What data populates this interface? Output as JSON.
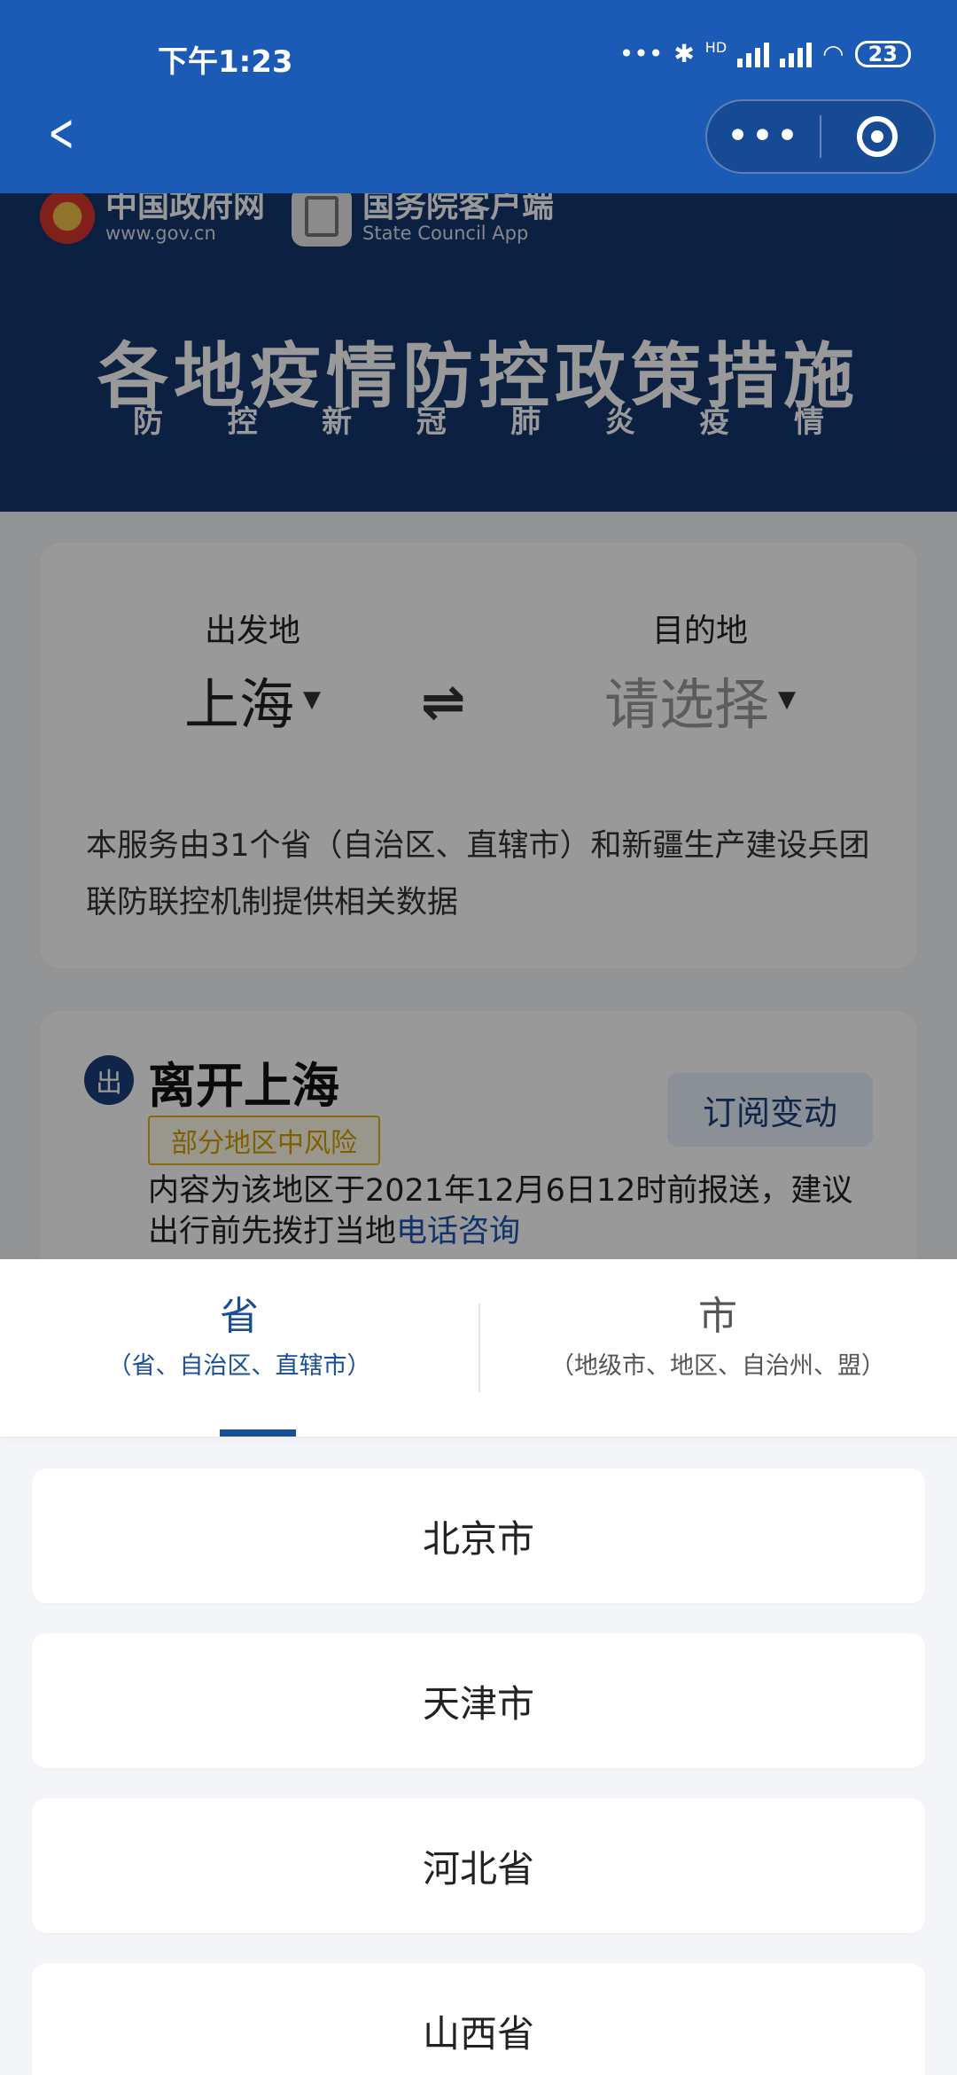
{
  "status_bar": {
    "time": "下午1:23",
    "dots": "•••",
    "hd": "HD",
    "battery": "23"
  },
  "nav": {
    "back_icon": "chevron-left-icon",
    "more": "•••",
    "close_icon": "target-icon"
  },
  "header": {
    "logo1_cn": "中国政府网",
    "logo1_en": "www.gov.cn",
    "logo2_cn": "国务院客户端",
    "logo2_en": "State Council App",
    "title": "各地疫情防控政策措施",
    "subtitle": [
      "防",
      "控",
      "新",
      "冠",
      "肺",
      "炎",
      "疫",
      "情"
    ]
  },
  "route": {
    "from_label": "出发地",
    "from_value": "上海",
    "to_label": "目的地",
    "to_value": "请选择",
    "notice": "本服务由31个省（自治区、直辖市）和新疆生产建设兵团联防联控机制提供相关数据"
  },
  "leave": {
    "badge": "出",
    "title": "离开上海",
    "risk": "部分地区中风险",
    "subscribe": "订阅变动",
    "detail": "内容为该地区于2021年12月6日12时前报送，建议出行前先拨打当地",
    "phone_link": "电话咨询"
  },
  "sheet": {
    "tabs": [
      {
        "title": "省",
        "sub": "（省、自治区、直辖市）",
        "active": true
      },
      {
        "title": "市",
        "sub": "（地级市、地区、自治州、盟）",
        "active": false
      }
    ],
    "items": [
      "北京市",
      "天津市",
      "河北省",
      "山西省"
    ]
  },
  "colors": {
    "topbar": "#1b5bb5",
    "hero": "#15366e",
    "active_tab": "#1a4f95",
    "risk": "#e2b21b"
  }
}
